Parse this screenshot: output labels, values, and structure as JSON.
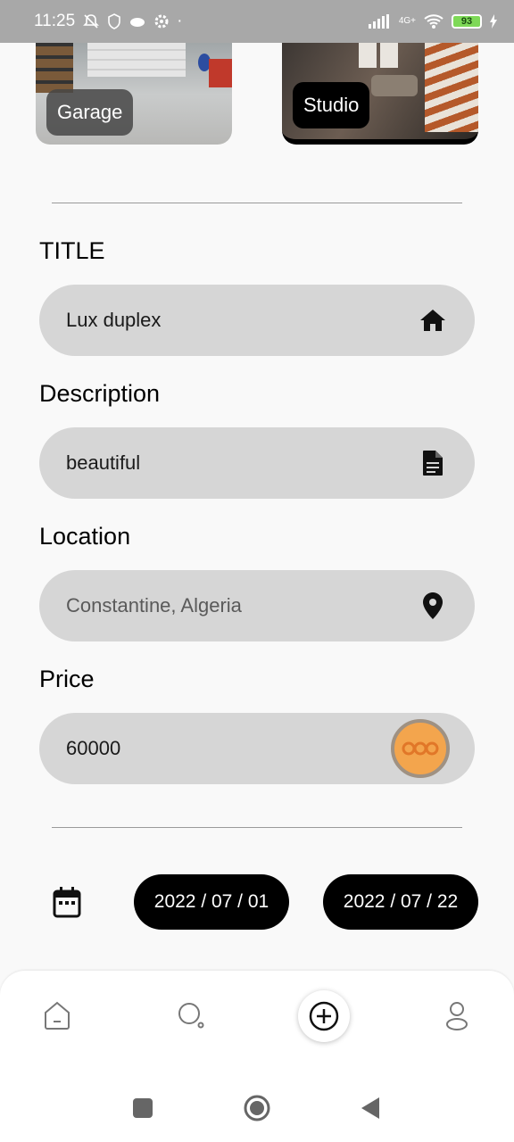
{
  "status_bar": {
    "time": "11:25",
    "network": "4G+",
    "battery": "93"
  },
  "categories": [
    {
      "label": "Garage"
    },
    {
      "label": "Studio"
    }
  ],
  "form": {
    "title": {
      "label": "TITLE",
      "value": "Lux duplex",
      "icon": "home-icon"
    },
    "description": {
      "label": "Description",
      "value": "beautiful",
      "icon": "document-icon"
    },
    "location": {
      "label": "Location",
      "placeholder": "Constantine, Algeria",
      "icon": "location-pin-icon"
    },
    "price": {
      "label": "Price",
      "value": "60000",
      "icon": "coin-icon"
    }
  },
  "dates": {
    "start": "2022 / 07 / 01",
    "end": "2022 / 07 / 22"
  },
  "nav": {
    "items": [
      "home-icon",
      "search-icon",
      "add-icon",
      "profile-icon"
    ]
  },
  "colors": {
    "field_bg": "#d6d6d6",
    "pill_bg": "#000000",
    "accent_coin": "#f7a03f"
  }
}
